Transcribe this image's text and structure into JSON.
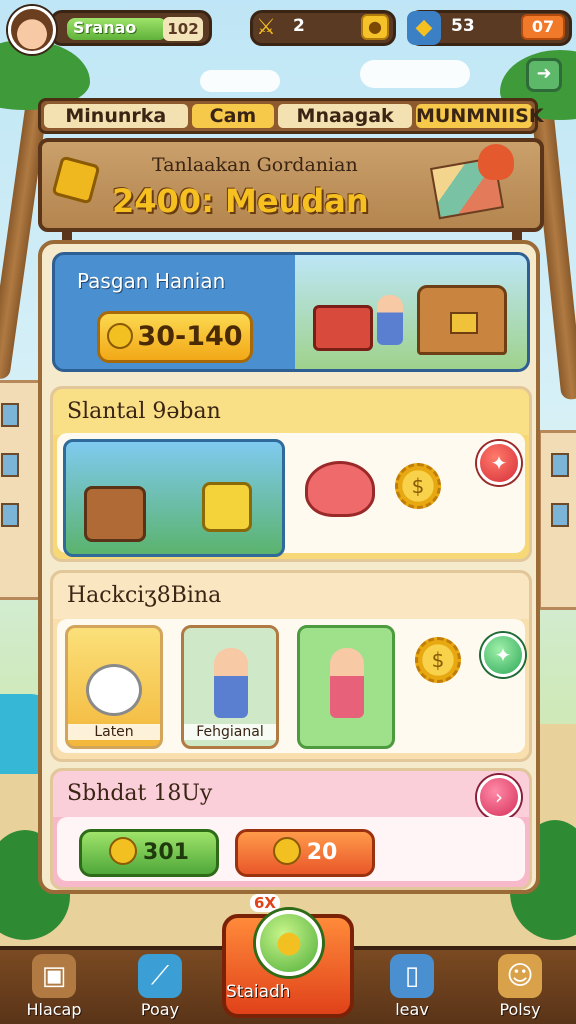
{
  "hud": {
    "xp_label": "Sranao",
    "level": "102",
    "gems_value": "2",
    "maps_value": "53",
    "maps_badge": "07"
  },
  "header_strip": [
    "Minunrka",
    "Cam",
    "Mnaagak",
    "MUNMNIISK"
  ],
  "sign": {
    "subtitle": "Tanlaakan Gordanian",
    "title": "2400: Meudan"
  },
  "banner": {
    "title": "Pasgan Hanian",
    "button_value": "30-140"
  },
  "section1": {
    "title": "Slantal 9əban"
  },
  "section2": {
    "title": "Hackciʒ8Bina",
    "cards": [
      {
        "label": "Laten"
      },
      {
        "label": "Fehgianal"
      }
    ]
  },
  "section3": {
    "title": "Sbhdat 18Uy",
    "rewards": [
      "301",
      "20"
    ]
  },
  "bottom_nav": {
    "items": [
      "Hlacap",
      "Poay",
      "Staiadh",
      "leav",
      "Polsy"
    ],
    "center_badge": "6X"
  },
  "colors": {
    "wood": "#8c5a2e",
    "accent_gold": "#f6c021",
    "accent_green": "#4fa83a",
    "accent_orange": "#e9572a"
  },
  "icons": [
    "avatar",
    "xp-coin-icon",
    "sword-icon",
    "gem-icon",
    "map-icon",
    "exit-icon",
    "chest-icon",
    "gear-coin-icon",
    "plus-icon",
    "check-icon",
    "arrow-right-icon",
    "bag-icon",
    "spyglass-icon",
    "phone-icon",
    "pirate-icon"
  ]
}
